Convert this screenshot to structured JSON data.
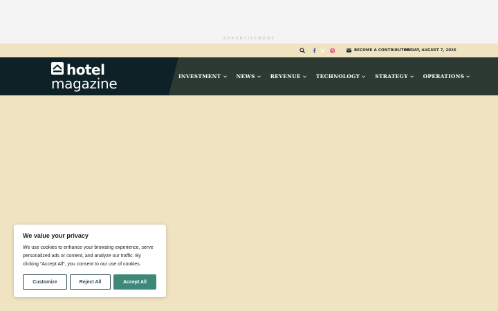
{
  "ad": {
    "label": "ADVERTISEMENT"
  },
  "topbar": {
    "icons": [
      "search-icon",
      "facebook-icon",
      "x-twitter-icon",
      "instagram-icon"
    ],
    "contributor_label": "BECOME A CONTRIBUTOR",
    "date": "FRIDAY, AUGUST 7, 2026"
  },
  "logo": {
    "word1": "hotel",
    "word2": "magazine"
  },
  "nav": {
    "items": [
      {
        "label": "INVESTMENT"
      },
      {
        "label": "NEWS"
      },
      {
        "label": "REVENUE"
      },
      {
        "label": "TECHNOLOGY"
      },
      {
        "label": "STRATEGY"
      },
      {
        "label": "OPERATIONS"
      }
    ]
  },
  "cookie": {
    "title": "We value your privacy",
    "text": "We use cookies to enhance your browsing experience, serve personalized ads or content, and analyze our traffic. By clicking \"Accept All\", you consent to our use of cookies.",
    "customize_label": "Customize",
    "reject_label": "Reject All",
    "accept_label": "Accept All"
  },
  "colors": {
    "background": "#efe3c1",
    "nav_dark": "#0d2126",
    "nav": "#2d3a33",
    "accent": "#3d8879",
    "instagram": "#d6306d",
    "facebook": "#3b5998"
  }
}
